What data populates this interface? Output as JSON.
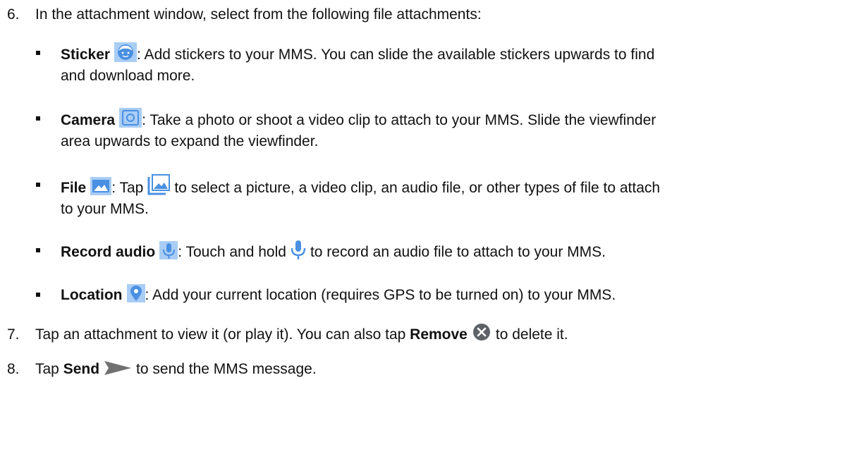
{
  "step6": {
    "number": "6.",
    "text": "In the attachment window, select from the following file attachments:",
    "items": [
      {
        "label": "Sticker",
        "icon": "sticker-icon",
        "line1": ": Add stickers to your MMS. You can slide the available stickers upwards to find",
        "line2": "and download more."
      },
      {
        "label": "Camera",
        "icon": "camera-icon",
        "line1": ": Take a photo or shoot a video clip to attach to your MMS. Slide the viewfinder",
        "line2": "area upwards to expand the viewfinder."
      },
      {
        "label": "File",
        "icon": "image-file-icon",
        "line1a": ": Tap",
        "inline_icon": "gallery-icon",
        "line1b": "to select a picture, a video clip, an audio file, or other types of file to attach",
        "line2": "to your MMS."
      },
      {
        "label": "Record audio",
        "icon": "microphone-tile-icon",
        "line1a": ": Touch and hold",
        "inline_icon": "microphone-icon",
        "line1b": "to record an audio file to attach to your MMS."
      },
      {
        "label": "Location",
        "icon": "location-pin-icon",
        "line1": ": Add your current location (requires GPS to be turned on) to your MMS."
      }
    ]
  },
  "step7": {
    "number": "7.",
    "text_a": "Tap an attachment to view it (or play it). You can also tap",
    "bold": "Remove",
    "text_b": "to delete it.",
    "icon": "remove-circle-icon"
  },
  "step8": {
    "number": "8.",
    "text_a": "Tap",
    "bold": "Send",
    "text_b": "to send the MMS message.",
    "icon": "send-arrow-icon"
  },
  "colors": {
    "icon_blue": "#4a90e2",
    "icon_light": "#a9cdf5",
    "remove_gray": "#5f6368",
    "send_gray": "#707070"
  }
}
